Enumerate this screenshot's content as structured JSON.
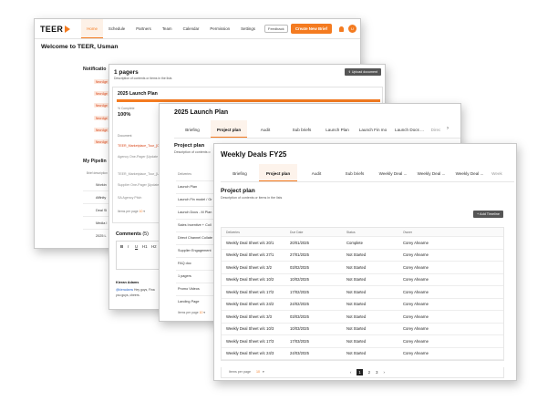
{
  "dashboard": {
    "logo": "TEER",
    "nav": [
      "Home",
      "Schedule",
      "Partners",
      "Team",
      "Calendar",
      "Permission",
      "Settings"
    ],
    "feedback": "Feedback",
    "create_button": "Create New Brief",
    "avatar_initials": "U",
    "welcome": "Welcome to TEER, Usman",
    "notifications_title": "Notificatio",
    "notification_tag": "New Age",
    "pipeline_title": "My Pipelin",
    "pipeline_header": "Brief description",
    "pipeline_rows": [
      "Workin",
      "Affinity",
      "Deal Sl",
      "Media I",
      "2025 L"
    ]
  },
  "pagers": {
    "title": "1 pagers",
    "description": "Description of contents or items in the lists",
    "upload_button": "Upload document",
    "card_title": "2025 Launch Plan",
    "completion_label": "% Complete",
    "completion_value": "100%",
    "document_label": "Document",
    "documents": [
      "TEER_Marketplace_Tour_[Cli",
      "Agency One-Pager [Update",
      "TEER_Marketplace_Tour_[Up",
      "Supplier One-Pager [Update",
      "SA Agency Pitch"
    ],
    "items_per_page": "Items per page",
    "items_per_page_value": "10",
    "comments_title": "Comments",
    "comments_count": "(5)",
    "editor_tools": [
      "B",
      "I",
      "U",
      "H1",
      "H2"
    ],
    "commenter": "Kieran Adams",
    "comment_mention": "@kieradams",
    "comment_text": " Hey guys, Fina",
    "comment_text_2": "you guys, cheers."
  },
  "launch_plan": {
    "title": "2025 Launch Plan",
    "tabs": [
      "Briefing",
      "Project plan",
      "Audit",
      "Sub briefs",
      "Launch Plan",
      "Launch Fin mo",
      "Launch Docs ...",
      "Direc"
    ],
    "active_tab": 1,
    "subtitle": "Project plan",
    "description": "Description of contents o",
    "column_header": "Deliveries",
    "rows": [
      "Launch Plan",
      "Launch Fin model / Gr",
      "Launch Docs - M Plan",
      "Sales Incentive + Coll",
      "Direct Channel Collate",
      "Supplier Engagement",
      "FAQ doc",
      "1 pagers",
      "Promo Videos",
      "Landing Page"
    ],
    "items_per_page": "Items per page",
    "items_per_page_value": "10"
  },
  "weekly_deals": {
    "title": "Weekly Deals FY25",
    "tabs": [
      "Briefing",
      "Project plan",
      "Audit",
      "Sub briefs",
      "Weekly Deal ...",
      "Weekly Deal ...",
      "Weekly Deal ...",
      "Week"
    ],
    "active_tab": 1,
    "subtitle": "Project plan",
    "description": "Description of contents or items in the lists",
    "add_button": "+ Add Timeline",
    "columns": [
      "Deliveries",
      "Due Date",
      "Status",
      "Owner"
    ],
    "rows": [
      [
        "Weekly Deal Sheet w/c 20/1",
        "20/01/2025",
        "Complete",
        "Corey Ahearne"
      ],
      [
        "Weekly Deal Sheet w/c 27/1",
        "27/01/2025",
        "Not Started",
        "Corey Ahearne"
      ],
      [
        "Weekly Deal Sheet w/c 3/2",
        "03/02/2025",
        "Not Started",
        "Corey Ahearne"
      ],
      [
        "Weekly Deal Sheet w/c 10/2",
        "10/02/2025",
        "Not Started",
        "Corey Ahearne"
      ],
      [
        "Weekly Deal Sheet w/c 17/2",
        "17/02/2025",
        "Not Started",
        "Corey Ahearne"
      ],
      [
        "Weekly Deal Sheet w/c 24/2",
        "24/02/2025",
        "Not Started",
        "Corey Ahearne"
      ],
      [
        "Weekly Deal Sheet w/c 3/3",
        "03/03/2025",
        "Not Started",
        "Corey Ahearne"
      ],
      [
        "Weekly Deal Sheet w/c 10/3",
        "10/03/2025",
        "Not Started",
        "Corey Ahearne"
      ],
      [
        "Weekly Deal Sheet w/c 17/3",
        "17/03/2025",
        "Not Started",
        "Corey Ahearne"
      ],
      [
        "Weekly Deal Sheet w/c 24/3",
        "24/03/2025",
        "Not Started",
        "Corey Ahearne"
      ]
    ],
    "items_per_page": "Items per page",
    "items_per_page_value": "10",
    "pagination": [
      "‹",
      "1",
      "2",
      "3",
      "›"
    ],
    "current_page": "1"
  },
  "colors": {
    "accent": "#f47b20",
    "dark_button": "#555555",
    "link": "#2a66c7"
  },
  "icons": [
    "teer-logo-icon",
    "bell-icon",
    "upload-icon",
    "chevron-right-icon",
    "plus-icon"
  ]
}
